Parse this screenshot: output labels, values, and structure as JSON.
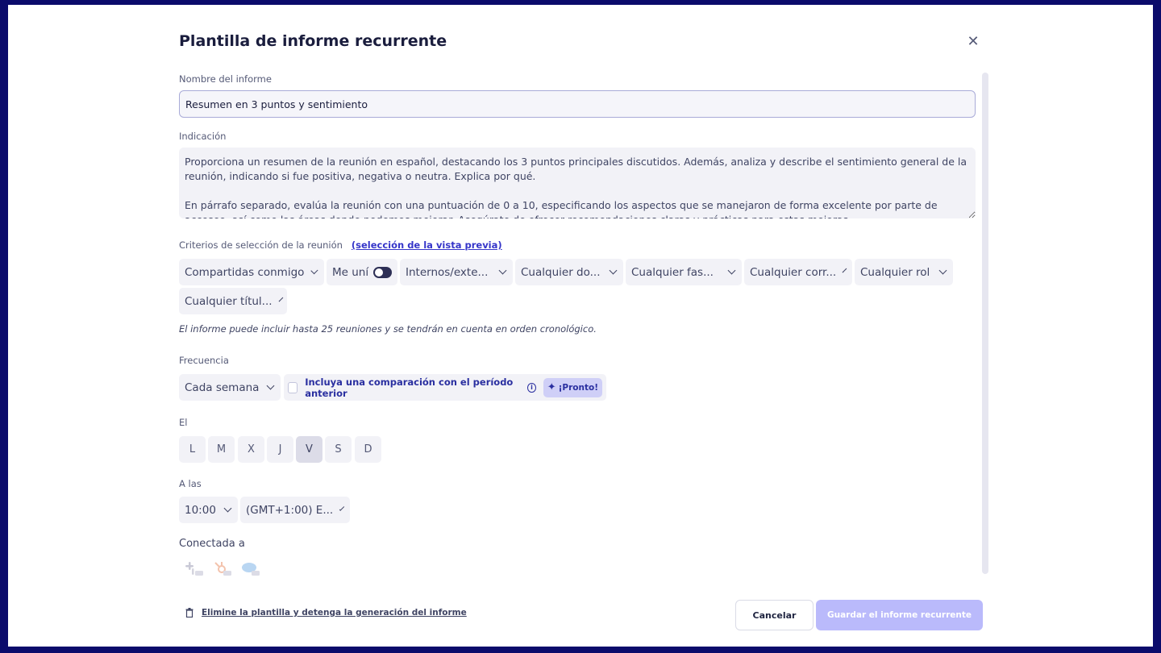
{
  "modal": {
    "title": "Plantilla de informe recurrente",
    "close_icon": "close-icon"
  },
  "name_field": {
    "label": "Nombre del informe",
    "value": "Resumen en 3 puntos y sentimiento"
  },
  "prompt_field": {
    "label": "Indicación",
    "value": "Proporciona un resumen de la reunión en español, destacando los 3 puntos principales discutidos. Además, analiza y describe el sentimiento general de la reunión, indicando si fue positiva, negativa o neutra. Explica por qué.\n\nEn párrafo separado, evalúa la reunión con una puntuación de 0 a 10, especificando los aspectos que se manejaron de forma excelente por parte de acceseo, así como las áreas donde podemos mejorar. Asegúrate de ofrecer recomendaciones claras y prácticas para estas mejoras."
  },
  "criteria": {
    "label": "Criterios de selección de la reunión",
    "preview_link": "(selección de la vista previa)",
    "filters": [
      "Compartidas conmigo",
      "Me uní",
      "Internos/exte...",
      "Cualquier do...",
      "Cualquier fas...",
      "Cualquier corr...",
      "Cualquier rol",
      "Cualquier títul..."
    ],
    "note": "El informe puede incluir hasta 25 reuniones y se tendrán en cuenta en orden cronológico."
  },
  "frequency": {
    "label": "Frecuencia",
    "value": "Cada semana",
    "comparison_text": "Incluya una comparación con el período anterior",
    "info_icon": "info-icon",
    "soon_badge": "¡Pronto!"
  },
  "days": {
    "label": "El",
    "items": [
      "L",
      "M",
      "X",
      "J",
      "V",
      "S",
      "D"
    ],
    "selected": "V"
  },
  "time": {
    "label": "A las",
    "hour": "10:00",
    "timezone": "(GMT+1:00) E..."
  },
  "connected": {
    "label": "Conectada a",
    "icons": [
      "slack-icon",
      "hubspot-icon",
      "salesforce-icon"
    ]
  },
  "footer": {
    "delete_link": "Elimine la plantilla y detenga la generación del informe",
    "cancel_label": "Cancelar",
    "save_label": "Guardar el informe recurrente"
  },
  "colors": {
    "frame": "#0b0b6b",
    "accent": "#3535c9",
    "save_disabled": "#babafb"
  }
}
